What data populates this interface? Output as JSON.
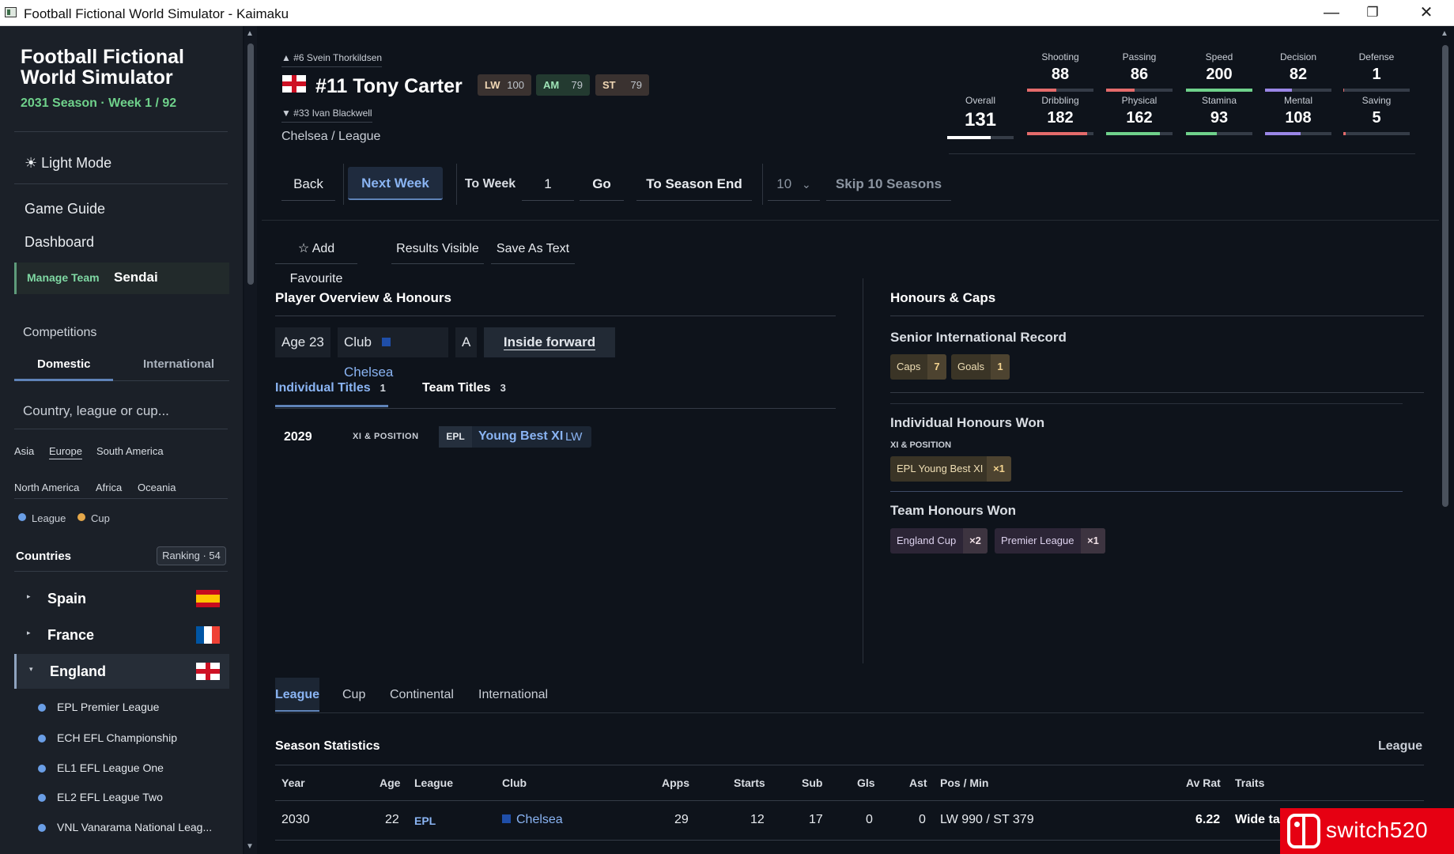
{
  "window": {
    "title": "Football Fictional World Simulator - Kaimaku",
    "minimize": "—",
    "maximize": "❐",
    "close": "✕"
  },
  "sidebar": {
    "app_title": "Football Fictional World Simulator",
    "season": "2031 Season · Week 1 / 92",
    "light_mode": "☀ Light Mode",
    "nav": {
      "guide": "Game Guide",
      "dashboard": "Dashboard"
    },
    "manage": {
      "label": "Manage Team",
      "team": "Sendai"
    },
    "competitions": "Competitions",
    "comp_tabs": {
      "domestic": "Domestic",
      "international": "International"
    },
    "search_placeholder": "Country, league or cup...",
    "regions": [
      "Asia",
      "Europe",
      "South America",
      "North America",
      "Africa",
      "Oceania"
    ],
    "legend": {
      "league": "League",
      "cup": "Cup",
      "league_color": "#6a9ee6",
      "cup_color": "#e5a84a"
    },
    "countries_label": "Countries",
    "ranking": "Ranking · 54",
    "countries": [
      {
        "name": "Spain",
        "caret": "▸"
      },
      {
        "name": "France",
        "caret": "▸"
      },
      {
        "name": "England",
        "caret": "▾"
      }
    ],
    "leagues": [
      "EPL Premier League",
      "ECH EFL Championship",
      "EL1 EFL League One",
      "EL2 EFL League Two",
      "VNL Vanarama National Leag..."
    ]
  },
  "player": {
    "prev": "▲ #6 Svein Thorkildsen",
    "next": "▼ #33 Ivan Blackwell",
    "name": "#11 Tony Carter",
    "positions": [
      {
        "pos": "LW",
        "rating": "100"
      },
      {
        "pos": "AM",
        "rating": "79"
      },
      {
        "pos": "ST",
        "rating": "79"
      }
    ],
    "club_league": "Chelsea / League",
    "overall": {
      "label": "Overall",
      "value": "131",
      "level": 0.65
    },
    "stats_top": [
      {
        "label": "Shooting",
        "value": "88",
        "level": 0.44,
        "color": "#e46b6b"
      },
      {
        "label": "Passing",
        "value": "86",
        "level": 0.43,
        "color": "#e46b6b"
      },
      {
        "label": "Speed",
        "value": "200",
        "level": 1.0,
        "color": "#6fd18b"
      },
      {
        "label": "Decision",
        "value": "82",
        "level": 0.41,
        "color": "#9a86e6"
      },
      {
        "label": "Defense",
        "value": "1",
        "level": 0.01,
        "color": "#e46b6b"
      }
    ],
    "stats_bottom": [
      {
        "label": "Dribbling",
        "value": "182",
        "level": 0.91,
        "color": "#e46b6b"
      },
      {
        "label": "Physical",
        "value": "162",
        "level": 0.81,
        "color": "#6fd18b"
      },
      {
        "label": "Stamina",
        "value": "93",
        "level": 0.47,
        "color": "#6fd18b"
      },
      {
        "label": "Mental",
        "value": "108",
        "level": 0.54,
        "color": "#9a86e6"
      },
      {
        "label": "Saving",
        "value": "5",
        "level": 0.03,
        "color": "#e46b6b"
      }
    ]
  },
  "controls": {
    "back": "Back",
    "next_week": "Next Week",
    "to_week": "To Week",
    "week_value": "1",
    "go": "Go",
    "season_end": "To Season End",
    "skip_count": "10",
    "skip_seasons": "Skip 10 Seasons"
  },
  "actions": {
    "favourite": "☆ Add Favourite",
    "results": "Results Visible",
    "save": "Save As Text"
  },
  "overview": {
    "heading": "Player Overview & Honours",
    "age": "Age 23",
    "club_label": "Club",
    "club": "Chelsea",
    "grade": "A",
    "role": "Inside forward",
    "tabs": [
      {
        "label": "Individual Titles",
        "count": "1"
      },
      {
        "label": "Team Titles",
        "count": "3"
      }
    ],
    "titles": [
      {
        "year": "2029",
        "category": "XI & POSITION",
        "comp": "EPL",
        "title": "Young Best XI",
        "pos": "LW"
      }
    ]
  },
  "honours": {
    "heading": "Honours & Caps",
    "international_heading": "Senior International Record",
    "caps": {
      "label": "Caps",
      "value": "7"
    },
    "goals": {
      "label": "Goals",
      "value": "1"
    },
    "individual_heading": "Individual Honours Won",
    "individual_cat": "XI & POSITION",
    "individual": [
      {
        "label": "EPL Young Best XI",
        "count": "×1"
      }
    ],
    "team_heading": "Team Honours Won",
    "team": [
      {
        "label": "England Cup",
        "count": "×2"
      },
      {
        "label": "Premier League",
        "count": "×1"
      }
    ]
  },
  "stats_tabs": [
    "League",
    "Cup",
    "Continental",
    "International"
  ],
  "season_stats": {
    "heading": "Season Statistics",
    "filter": "League",
    "columns": [
      "Year",
      "Age",
      "League",
      "Club",
      "Apps",
      "Starts",
      "Sub",
      "Gls",
      "Ast",
      "Pos / Min",
      "Av Rat",
      "Traits"
    ],
    "rows": [
      {
        "year": "2030",
        "age": "22",
        "league": "EPL",
        "club": "Chelsea",
        "apps": "29",
        "starts": "12",
        "sub": "17",
        "gls": "0",
        "ast": "0",
        "posmin": "LW 990 / ST 379",
        "rating": "6.22",
        "traits": "Wide ta"
      }
    ]
  },
  "watermark": "switch520"
}
